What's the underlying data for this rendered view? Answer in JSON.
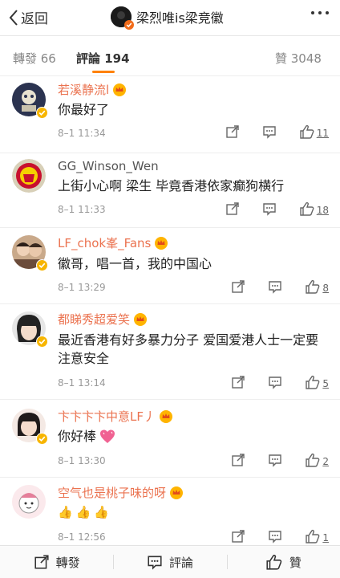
{
  "nav": {
    "back_label": "返回",
    "title": "梁烈唯is梁竞徽"
  },
  "tabs": {
    "reposts": "轉發 66",
    "comments": "評論 194",
    "likes": "贊 3048"
  },
  "comments": [
    {
      "name": "若溪静流l",
      "text": "你最好了",
      "time": "8–1 11:34",
      "likes": "11"
    },
    {
      "name": "GG_Winson_Wen",
      "text": "上街小心啊 梁生 毕竟香港依家癫狗横行",
      "time": "8–1 11:33",
      "likes": "18"
    },
    {
      "name": "LF_chok峯_Fans",
      "text": "徽哥，唱一首，我的中国心",
      "time": "8–1 13:29",
      "likes": "8"
    },
    {
      "name": "都睇秀超爱笑",
      "text": "最近香港有好多暴力分子 爱国爱港人士一定要注意安全",
      "time": "8–1 13:14",
      "likes": "5"
    },
    {
      "name": "卞卞卞卞中意LF丿",
      "text": "你好棒",
      "time": "8–1 13:30",
      "likes": "2"
    },
    {
      "name": "空气也是桃子味的呀",
      "text": "👍👍👍",
      "time": "8–1 12:56",
      "likes": "1"
    }
  ],
  "bottom": {
    "repost": "轉發",
    "comment": "評論",
    "like": "贊"
  },
  "colors": {
    "accent": "#ff8200",
    "vip_name": "#eb7350"
  }
}
